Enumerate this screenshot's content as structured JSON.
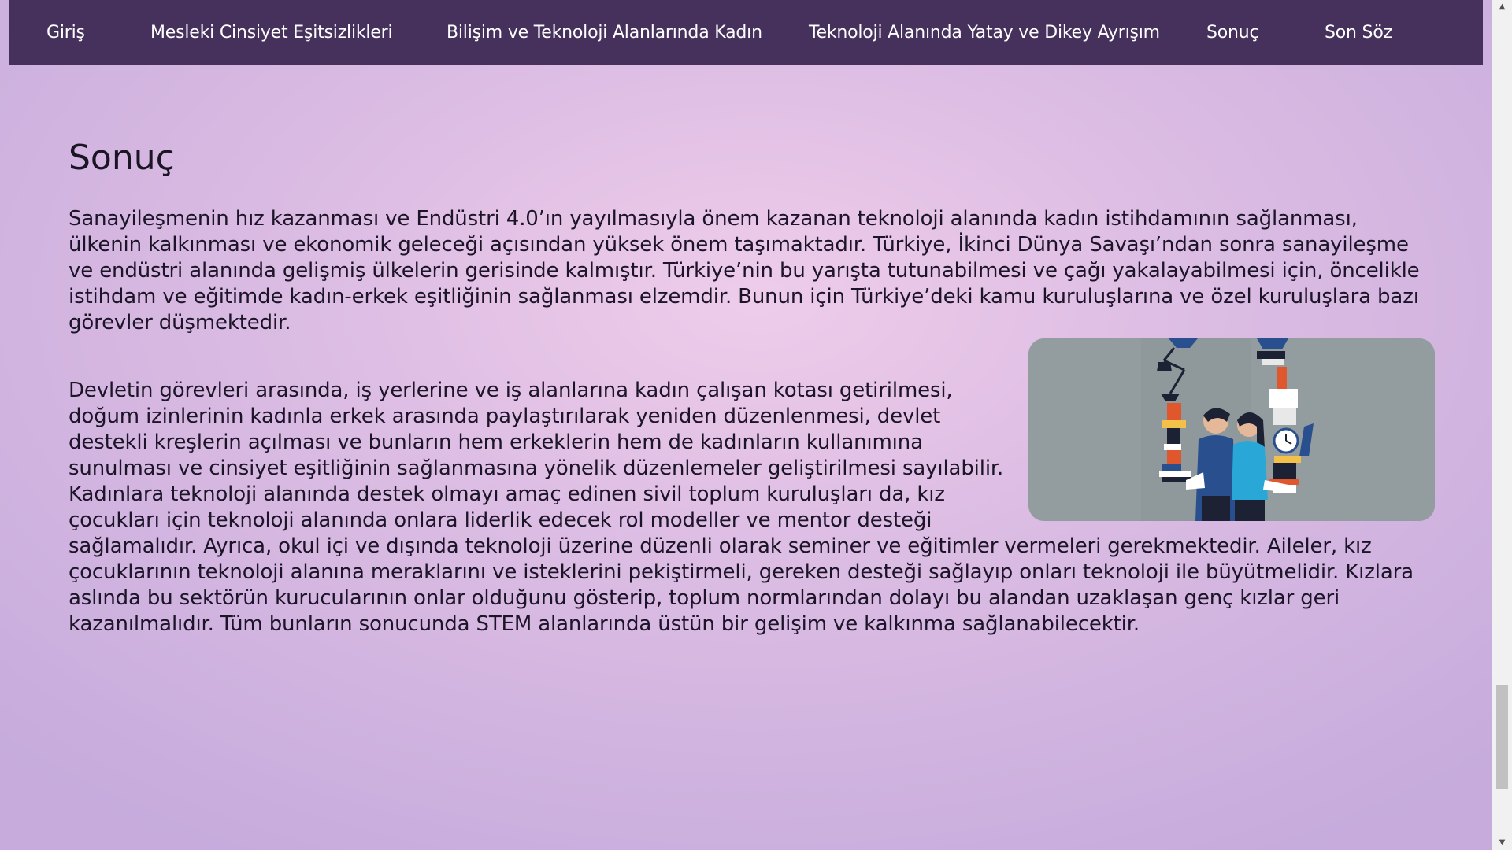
{
  "nav": {
    "items": [
      {
        "label": "Giriş"
      },
      {
        "label": "Mesleki Cinsiyet Eşitsizlikleri"
      },
      {
        "label": "Bilişim ve Teknoloji Alanlarında Kadın"
      },
      {
        "label": "Teknoloji Alanında Yatay ve Dikey Ayrışım"
      },
      {
        "label": "Sonuç"
      },
      {
        "label": "Son Söz"
      }
    ]
  },
  "main": {
    "title": "Sonuç",
    "paragraph1": "Sanayileşmenin hız kazanması ve Endüstri 4.0’ın yayılmasıyla önem kazanan teknoloji alanında kadın istihdamının sağlanması, ülkenin kalkınması ve ekonomik geleceği açısından yüksek önem taşımaktadır. Türkiye, İkinci Dünya Savaşı’ndan sonra sanayileşme ve endüstri alanında gelişmiş ülkelerin gerisinde kalmıştır. Türkiye’nin bu yarışta tutunabilmesi ve çağı yakalayabilmesi için, öncelikle istihdam ve eğitimde kadın-erkek eşitliğinin sağlanması elzemdir. Bunun için Türkiye’deki kamu kuruluşlarına ve özel kuruluşlara bazı görevler düşmektedir.",
    "paragraph2": "Devletin görevleri arasında, iş yerlerine ve iş alanlarına kadın çalışan kotası getirilmesi, doğum izinlerinin kadınla erkek arasında paylaştırılarak yeniden düzenlenmesi, devlet destekli kreşlerin açılması ve bunların hem erkeklerin hem de kadınların kullanımına sunulması ve cinsiyet eşitliğinin sağlanmasına yönelik düzenlemeler geliştirilmesi sayılabilir. Kadınlara teknoloji alanında destek olmayı amaç edinen sivil toplum kuruluşları da, kız çocukları için teknoloji alanında onlara liderlik edecek rol modeller ve mentor desteği sağlamalıdır. Ayrıca, okul içi ve dışında teknoloji üzerine düzenli olarak seminer ve eğitimler vermeleri gerekmektedir. Aileler, kız çocuklarının teknoloji alanına meraklarını ve isteklerini pekiştirmeli, gereken desteği sağlayıp onları teknoloji ile büyütmelidir. Kızlara aslında bu sektörün kurucularının onlar olduğunu gösterip, toplum normlarından dolayı bu alandan uzaklaşan genç kızlar geri kazanılmalıdır. Tüm bunların sonucunda STEM alanlarında üstün bir gelişim ve kalkınma sağlanabilecektir."
  },
  "illustration": {
    "icon": "man-woman-balancing-tech-objects-illustration",
    "background_color": "#939da0"
  },
  "colors": {
    "navbar": "#46305c",
    "nav_text": "#ffffff",
    "body_text": "#1c1428"
  },
  "scrollbar": {
    "up_icon": "triangle-up-icon",
    "down_icon": "triangle-down-icon",
    "position_fraction": 0.82
  }
}
